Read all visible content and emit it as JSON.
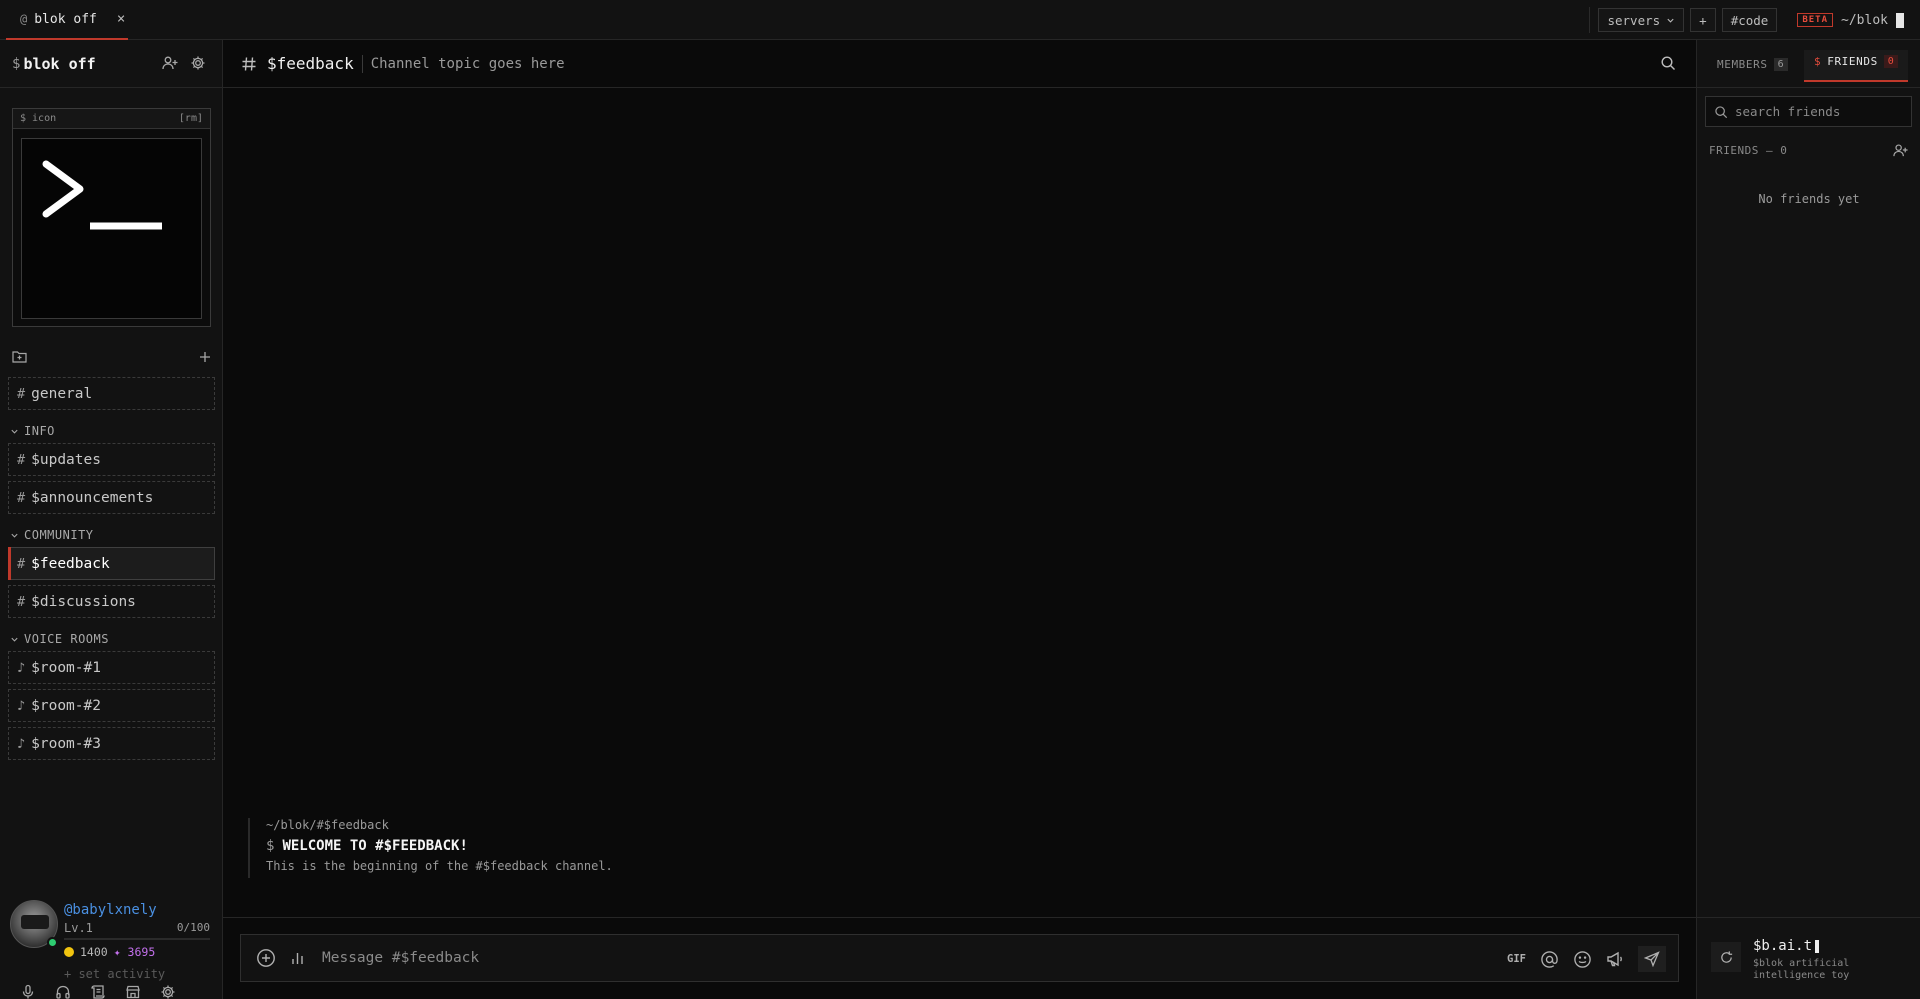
{
  "topbar": {
    "tab_at": "@",
    "tab_label": "blok off",
    "tab_close": "×",
    "servers_label": "servers",
    "add_label": "+",
    "code_label": "#code",
    "beta_label": "BETA",
    "path_label": "~/blok"
  },
  "sidebar": {
    "server_prefix": "$",
    "server_name": "blok off",
    "icon_box_label": "$ icon",
    "icon_box_remove": "[rm]",
    "channels": [
      {
        "hash": "#",
        "label": "general"
      },
      {
        "hash": "#",
        "label": "$updates"
      },
      {
        "hash": "#",
        "label": "$announcements"
      },
      {
        "hash": "#",
        "label": "$feedback"
      },
      {
        "hash": "#",
        "label": "$discussions"
      },
      {
        "hash": "♪",
        "label": "$room-#1"
      },
      {
        "hash": "♪",
        "label": "$room-#2"
      },
      {
        "hash": "♪",
        "label": "$room-#3"
      }
    ],
    "categories": [
      "INFO",
      "COMMUNITY",
      "VOICE ROOMS"
    ]
  },
  "user": {
    "handle": "@babylxnely",
    "level": "Lv.1",
    "xp": "0/100",
    "xp_fraction": 0,
    "coins": "1400",
    "gems": "✦ 3695",
    "activity_placeholder": "+ set activity",
    "status_color": "#2ecc71"
  },
  "channel": {
    "hash": "#",
    "title": "$feedback",
    "topic": "Channel topic goes here"
  },
  "welcome": {
    "path": "~/blok/#$feedback",
    "prompt": "$",
    "title": "WELCOME TO #$FEEDBACK!",
    "desc": "This is the beginning of the #$feedback channel."
  },
  "composer": {
    "placeholder": "Message #$feedback",
    "gif_label": "GIF"
  },
  "right": {
    "members_label": "MEMBERS",
    "members_count": "6",
    "friends_prefix": "$",
    "friends_label": "FRIENDS",
    "friends_count": "0",
    "search_placeholder": "search friends",
    "friends_header": "FRIENDS — 0",
    "empty_text": "No friends yet",
    "bot_name": "$b.ai.t",
    "bot_desc": "$blok artificial intelligence toy"
  },
  "colors": {
    "accent": "#c0392b",
    "link": "#4a90e2",
    "gem": "#c471ed",
    "coin": "#f1c40f"
  }
}
